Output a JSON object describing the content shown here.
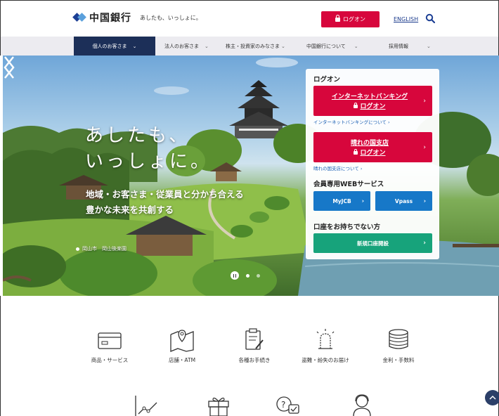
{
  "header": {
    "logo_text": "中国銀行",
    "tagline": "あしたも、いっしょに。",
    "logon_label": "ログオン",
    "english_label": "ENGLISH"
  },
  "nav": {
    "items": [
      {
        "label": "個人のお客さま"
      },
      {
        "label": "法人のお客さま"
      },
      {
        "label": "株主・投資家のみなさま"
      },
      {
        "label": "中国銀行について"
      },
      {
        "label": "採用情報"
      }
    ]
  },
  "hero": {
    "title_line1": "あしたも、",
    "title_line2": "いっしょに。",
    "sub_line1": "地域・お客さま・従業員と分かち合える",
    "sub_line2": "豊かな未来を共創する",
    "caption": "岡山市　岡山後楽園"
  },
  "logon_panel": {
    "heading": "ログオン",
    "ib_line1": "インターネットバンキング",
    "ib_line2": "ログオン",
    "ib_about": "インターネットバンキングについて ›",
    "hare_line1": "晴れの国支店",
    "hare_line2": "ログオン",
    "hare_about": "晴れの国支店について ›",
    "member_heading": "会員専用WEBサービス",
    "myjcb": "MyJCB",
    "vpass": "Vpass",
    "no_account_heading": "口座をお持ちでない方",
    "open_account": "新規口座開設"
  },
  "services": [
    {
      "label": "商品・サービス",
      "icon": "credit-card-icon"
    },
    {
      "label": "店舗・ATM",
      "icon": "map-pin-icon"
    },
    {
      "label": "各種お手続き",
      "icon": "clipboard-pen-icon"
    },
    {
      "label": "盗難・紛失のお届け",
      "icon": "alarm-light-icon"
    },
    {
      "label": "金利・手数料",
      "icon": "coins-icon"
    }
  ],
  "colors": {
    "brand_red": "#d7063c",
    "nav_active": "#1c2f58",
    "blue": "#1778c8",
    "green": "#17a37b"
  }
}
